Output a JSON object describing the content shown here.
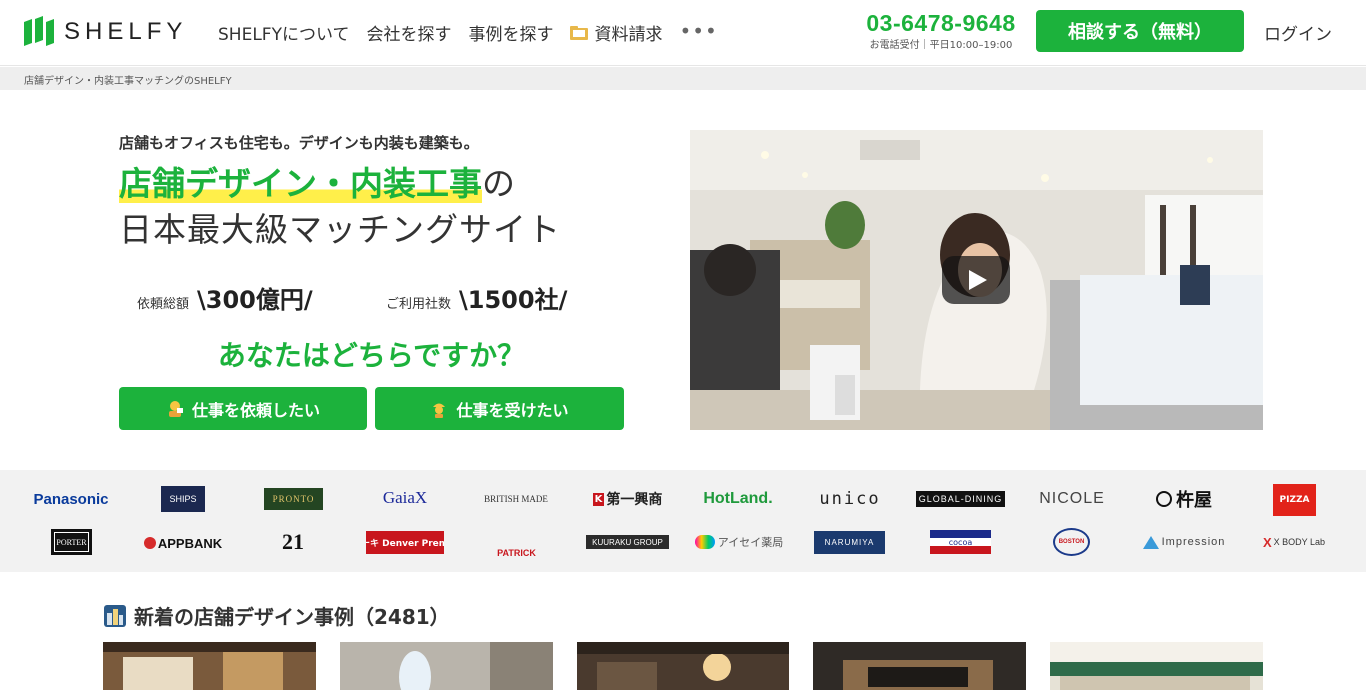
{
  "header": {
    "logo_text": "SHELFY",
    "nav": [
      {
        "label": "SHELFYについて"
      },
      {
        "label": "会社を探す"
      },
      {
        "label": "事例を探す"
      },
      {
        "label": "資料請求",
        "icon": "folder-icon"
      },
      {
        "label": "•••",
        "icon": "more-icon"
      }
    ],
    "phone": "03-6478-9648",
    "phone_hours": "お電話受付｜平日10:00–19:00",
    "consult_label": "相談する（無料）",
    "login_label": "ログイン"
  },
  "breadcrumb": "店舗デザイン・内装工事マッチングのSHELFY",
  "hero": {
    "subtitle": "店舗もオフィスも住宅も。デザインも内装も建築も。",
    "title_highlight": "店舗デザイン・内装工事",
    "title_suffix": "の",
    "title_line2": "日本最大級マッチングサイト",
    "stats": [
      {
        "label": "依頼総額",
        "value": "\\300億円/"
      },
      {
        "label": "ご利用社数",
        "value": "\\1500社/"
      }
    ],
    "question": "あなたはどちらですか？",
    "buttons": [
      {
        "label": "仕事を依頼したい",
        "icon": "request-icon"
      },
      {
        "label": "仕事を受けたい",
        "icon": "worker-icon"
      }
    ]
  },
  "logos": [
    [
      "Panasonic",
      "SHIPS",
      "PRONTO",
      "GaiaX",
      "BRITISH MADE",
      "第一興商",
      "HotLand.",
      "unico",
      "GLOBAL-DINING",
      "NICOLE",
      "杵屋",
      "PIZZA"
    ],
    [
      "PORTER",
      "APPBANK",
      "21",
      "ステーキ Denver Premium",
      "PATRICK",
      "KUURAKU GROUP",
      "アイセイ薬局",
      "NARUMIYA",
      "cocoa",
      "BOSTON",
      "Impression",
      "X BODY Lab"
    ]
  ],
  "section": {
    "title": "新着の店舗デザイン事例（2481）",
    "icon": "city-icon"
  },
  "colors": {
    "brand_green": "#1cb23c",
    "highlight_yellow": "#ffef4a"
  }
}
